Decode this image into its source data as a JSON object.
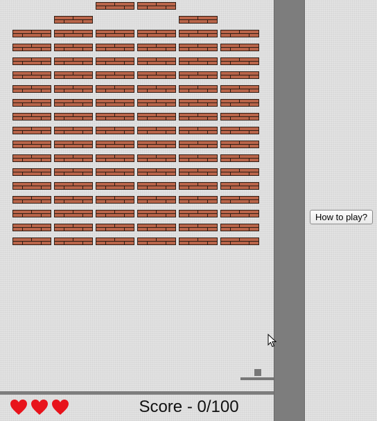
{
  "score": {
    "label": "Score - 0/100",
    "current": 0,
    "total": 100
  },
  "lives": {
    "count": 3,
    "icon": "heart-icon",
    "color": "#e8131b"
  },
  "help_button": {
    "label": "How to play?"
  },
  "bricks": {
    "top_row": [
      2,
      3
    ],
    "second_row": [
      1,
      4
    ],
    "full_rows": 16,
    "columns": 6,
    "color": "#b9654a",
    "mortar_color": "#2e1d14"
  },
  "colors": {
    "background": "#e2e2e2",
    "wall": "#7d7d7d",
    "paddle": "#777777",
    "ball": "#777777"
  }
}
